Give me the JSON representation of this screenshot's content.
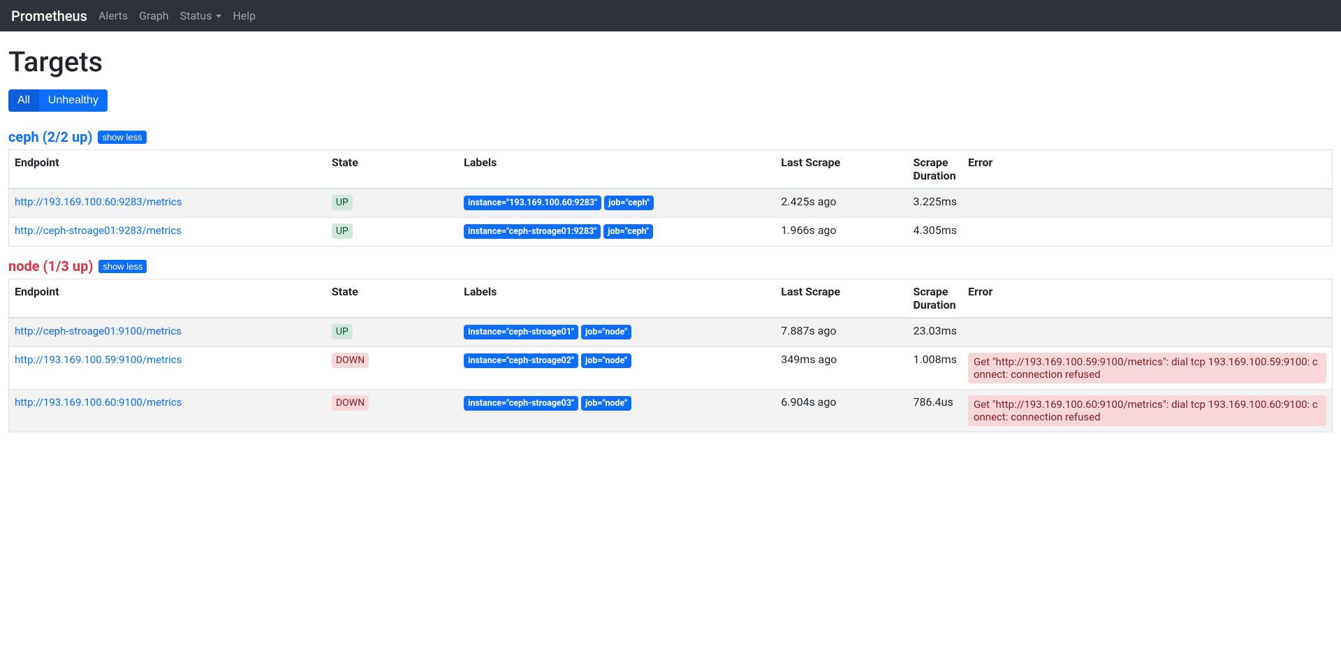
{
  "nav": {
    "brand": "Prometheus",
    "alerts": "Alerts",
    "graph": "Graph",
    "status": "Status",
    "help": "Help"
  },
  "page_title": "Targets",
  "filter": {
    "all": "All",
    "unhealthy": "Unhealthy"
  },
  "columns": {
    "endpoint": "Endpoint",
    "state": "State",
    "labels": "Labels",
    "last_scrape": "Last Scrape",
    "scrape_duration": "Scrape Duration",
    "error": "Error"
  },
  "show_less": "show less",
  "groups": [
    {
      "name": "ceph (2/2 up)",
      "healthy": true,
      "rows": [
        {
          "endpoint": "http://193.169.100.60:9283/metrics",
          "state": "UP",
          "labels": [
            "instance=\"193.169.100.60:9283\"",
            "job=\"ceph\""
          ],
          "last_scrape": "2.425s ago",
          "duration": "3.225ms",
          "error": ""
        },
        {
          "endpoint": "http://ceph-stroage01:9283/metrics",
          "state": "UP",
          "labels": [
            "instance=\"ceph-stroage01:9283\"",
            "job=\"ceph\""
          ],
          "last_scrape": "1.966s ago",
          "duration": "4.305ms",
          "error": ""
        }
      ]
    },
    {
      "name": "node (1/3 up)",
      "healthy": false,
      "rows": [
        {
          "endpoint": "http://ceph-stroage01:9100/metrics",
          "state": "UP",
          "labels": [
            "instance=\"ceph-stroage01\"",
            "job=\"node\""
          ],
          "last_scrape": "7.887s ago",
          "duration": "23.03ms",
          "error": ""
        },
        {
          "endpoint": "http://193.169.100.59:9100/metrics",
          "state": "DOWN",
          "labels": [
            "instance=\"ceph-stroage02\"",
            "job=\"node\""
          ],
          "last_scrape": "349ms ago",
          "duration": "1.008ms",
          "error": "Get \"http://193.169.100.59:9100/metrics\": dial tcp 193.169.100.59:9100: connect: connection refused"
        },
        {
          "endpoint": "http://193.169.100.60:9100/metrics",
          "state": "DOWN",
          "labels": [
            "instance=\"ceph-stroage03\"",
            "job=\"node\""
          ],
          "last_scrape": "6.904s ago",
          "duration": "786.4us",
          "error": "Get \"http://193.169.100.60:9100/metrics\": dial tcp 193.169.100.60:9100: connect: connection refused"
        }
      ]
    }
  ]
}
